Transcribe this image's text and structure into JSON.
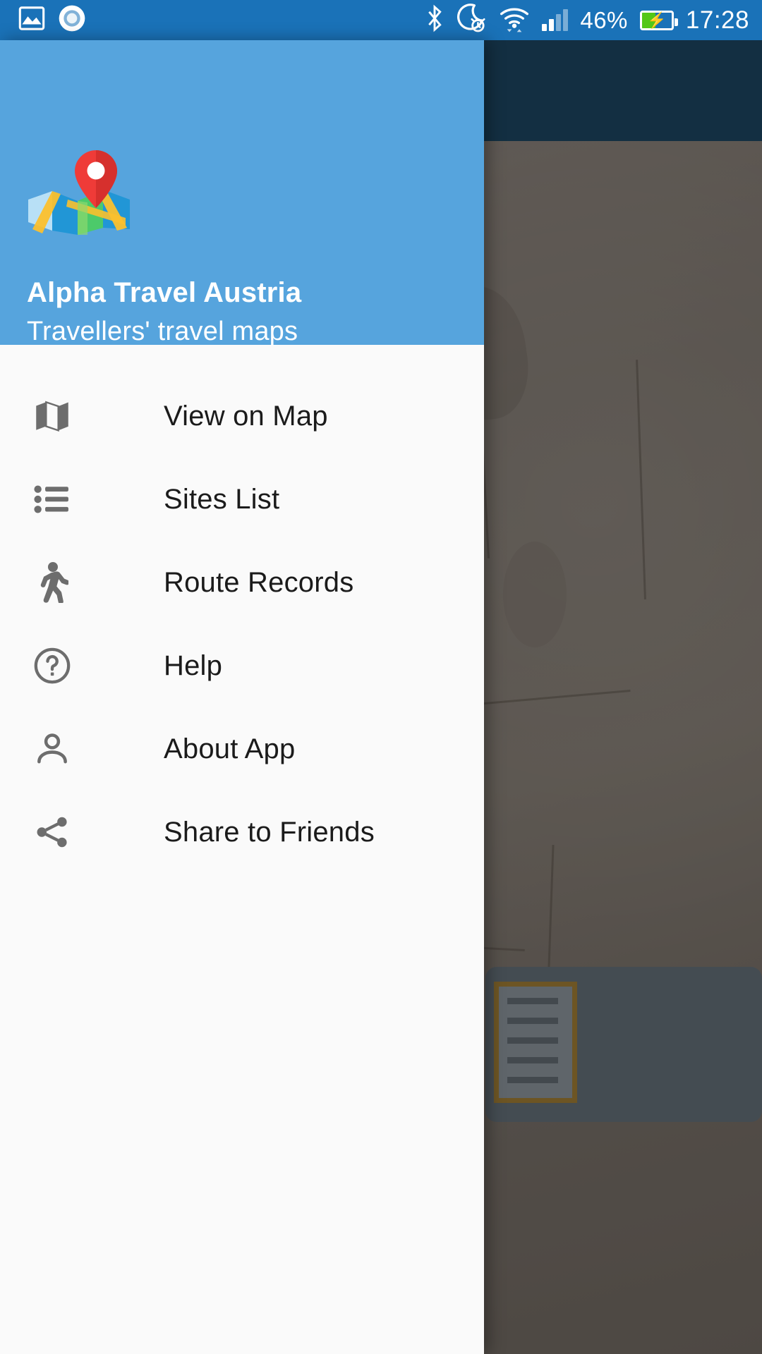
{
  "statusbar": {
    "left_icons": [
      {
        "name": "screenshot-image-icon",
        "glyph": "image"
      },
      {
        "name": "recording-circle-icon",
        "glyph": "circle"
      }
    ],
    "right_icons": [
      {
        "name": "bluetooth-icon",
        "glyph": "bluetooth"
      },
      {
        "name": "do-not-disturb-alarm-icon",
        "glyph": "moon-alarm"
      },
      {
        "name": "wifi-icon",
        "glyph": "wifi"
      }
    ],
    "signal": {
      "bars_total": 4,
      "bars_filled": 2
    },
    "battery_percent": "46%",
    "battery_level": 46,
    "battery_charging": true,
    "clock": "17:28"
  },
  "drawer": {
    "logo_icon": "map-with-pin-logo",
    "title": "Alpha Travel Austria",
    "subtitle": "Travellers' travel maps",
    "header_color": "#56a4dd",
    "items": [
      {
        "label": "View on Map",
        "icon": "map-icon"
      },
      {
        "label": "Sites List",
        "icon": "list-bulleted-icon"
      },
      {
        "label": "Route Records",
        "icon": "walking-person-icon"
      },
      {
        "label": "Help",
        "icon": "help-circle-icon"
      },
      {
        "label": "About App",
        "icon": "person-icon"
      },
      {
        "label": "Share to Friends",
        "icon": "share-nodes-icon"
      }
    ]
  },
  "background": {
    "toolbar_color": "#1f4d6b",
    "scrim": "dimmed"
  }
}
